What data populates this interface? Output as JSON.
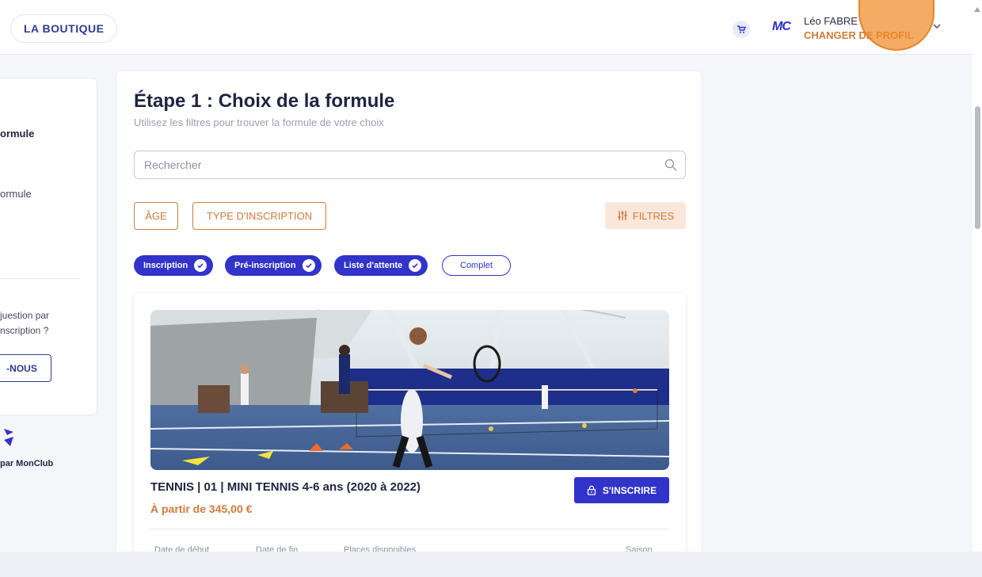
{
  "header": {
    "shop_label": "LA BOUTIQUE",
    "cart_icon": "cart-icon",
    "logo_text": "MC",
    "user_name": "Léo FABRE",
    "profile_link": "CHANGER DE PROFIL"
  },
  "sidebar": {
    "step1": "ormule",
    "step2": "ormule",
    "question_line1": "juestion par",
    "question_line2": "nscription ?",
    "contact_label": "-NOUS",
    "powered": "par MonClub"
  },
  "main": {
    "title": "Étape 1 : Choix de la formule",
    "subtitle": "Utilisez les filtres pour trouver la formule de votre choix",
    "search_placeholder": "Rechercher",
    "filter_age": "ÂGE",
    "filter_type": "TYPE D'INSCRIPTION",
    "filters_label": "FILTRES",
    "chips": [
      {
        "label": "Inscription",
        "active": true
      },
      {
        "label": "Pré-inscription",
        "active": true
      },
      {
        "label": "Liste d'attente",
        "active": true
      },
      {
        "label": "Complet",
        "active": false
      }
    ]
  },
  "card": {
    "title": "TENNIS | 01 | MINI TENNIS 4-6 ans (2020 à 2022)",
    "price": "À partir de 345,00 €",
    "signup_label": "S'INSCRIRE",
    "meta": {
      "start": "Date de début",
      "end": "Date de fin",
      "places": "Places disponibles",
      "season": "Saison"
    }
  },
  "colors": {
    "primary": "#3233c9",
    "accent": "#d07a3c",
    "navy": "#2f3a8f"
  }
}
